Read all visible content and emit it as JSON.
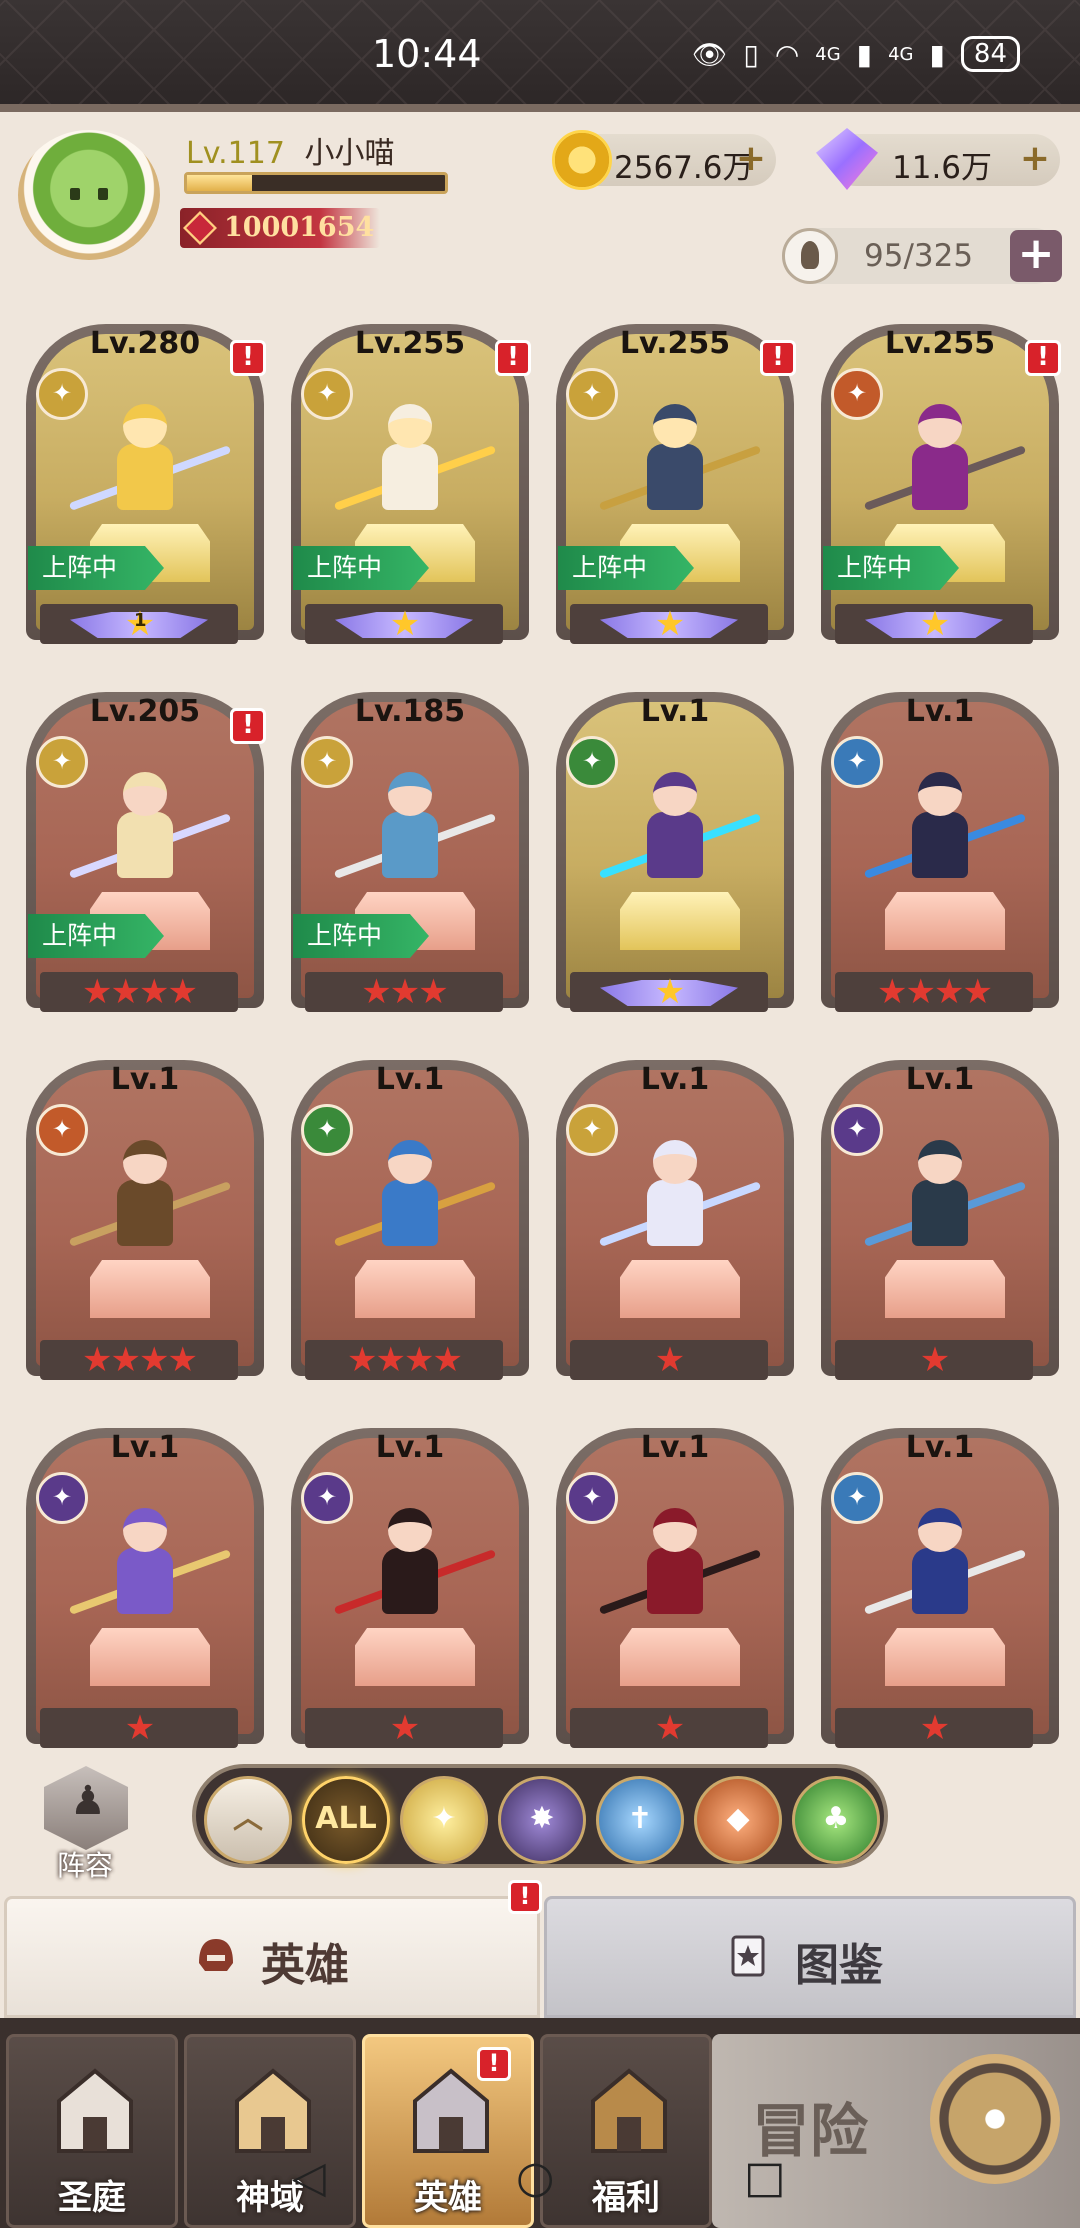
{
  "status_bar": {
    "time": "10:44",
    "network_1": "4G",
    "network_2": "4G",
    "battery": "84"
  },
  "player": {
    "level": "Lv.117",
    "name": "小小喵",
    "power": "10001654",
    "exp_progress": 0.25
  },
  "currency": {
    "gold": "2567.6万",
    "diamonds": "11.6万"
  },
  "hero_capacity": "95/325",
  "heroes": [
    {
      "level": "Lv.280",
      "stars": "★",
      "star_count_label": "1",
      "faction": "light",
      "deployed": true,
      "alert": true,
      "gold": true
    },
    {
      "level": "Lv.255",
      "stars": "★",
      "faction": "light",
      "deployed": true,
      "alert": true,
      "gold": true
    },
    {
      "level": "Lv.255",
      "stars": "★",
      "faction": "light",
      "deployed": true,
      "alert": true,
      "gold": true
    },
    {
      "level": "Lv.255",
      "stars": "★",
      "faction": "beast",
      "deployed": true,
      "alert": true,
      "gold": true
    },
    {
      "level": "Lv.205",
      "stars": "★★★★",
      "faction": "light",
      "deployed": true,
      "alert": true,
      "gold": false
    },
    {
      "level": "Lv.185",
      "stars": "★★★",
      "faction": "light",
      "deployed": true,
      "alert": false,
      "gold": false
    },
    {
      "level": "Lv.1",
      "stars": "★",
      "faction": "nature",
      "deployed": false,
      "alert": false,
      "gold": true
    },
    {
      "level": "Lv.1",
      "stars": "★★★★",
      "faction": "holy",
      "deployed": false,
      "alert": false,
      "gold": false
    },
    {
      "level": "Lv.1",
      "stars": "★★★★",
      "faction": "beast",
      "deployed": false,
      "alert": false,
      "gold": false
    },
    {
      "level": "Lv.1",
      "stars": "★★★★",
      "faction": "nature",
      "deployed": false,
      "alert": false,
      "gold": false
    },
    {
      "level": "Lv.1",
      "stars": "★",
      "faction": "light",
      "deployed": false,
      "alert": false,
      "gold": false
    },
    {
      "level": "Lv.1",
      "stars": "★",
      "faction": "dark",
      "deployed": false,
      "alert": false,
      "gold": false
    },
    {
      "level": "Lv.1",
      "stars": "★",
      "faction": "dark",
      "deployed": false,
      "alert": false,
      "gold": false
    },
    {
      "level": "Lv.1",
      "stars": "★",
      "faction": "dark",
      "deployed": false,
      "alert": false,
      "gold": false
    },
    {
      "level": "Lv.1",
      "stars": "★",
      "faction": "dark",
      "deployed": false,
      "alert": false,
      "gold": false
    },
    {
      "level": "Lv.1",
      "stars": "★",
      "faction": "holy",
      "deployed": false,
      "alert": false,
      "gold": false
    }
  ],
  "deployed_label": "上阵中",
  "lineup_label": "阵容",
  "filters": [
    {
      "name": "collapse",
      "label": "︿"
    },
    {
      "name": "all",
      "label": "ALL"
    },
    {
      "name": "light",
      "label": "✦"
    },
    {
      "name": "dark",
      "label": "✸"
    },
    {
      "name": "holy",
      "label": "✝"
    },
    {
      "name": "beast",
      "label": "◆"
    },
    {
      "name": "nature",
      "label": "♣"
    }
  ],
  "tabs": {
    "hero": "英雄",
    "codex": "图鉴",
    "alert": "!"
  },
  "bottom_nav": [
    {
      "label": "圣庭",
      "alert": false
    },
    {
      "label": "神域",
      "alert": false
    },
    {
      "label": "英雄",
      "alert": true
    },
    {
      "label": "福利",
      "alert": false
    }
  ],
  "adventure_label": "冒险",
  "alert_mark": "!",
  "system_nav": {
    "back": "◁",
    "home": "○",
    "recent": "□"
  },
  "colors": {
    "light": "#c9a23a",
    "dark": "#5a3a8a",
    "holy": "#3a7ab8",
    "beast": "#c25a2a",
    "nature": "#3a8a3a"
  }
}
